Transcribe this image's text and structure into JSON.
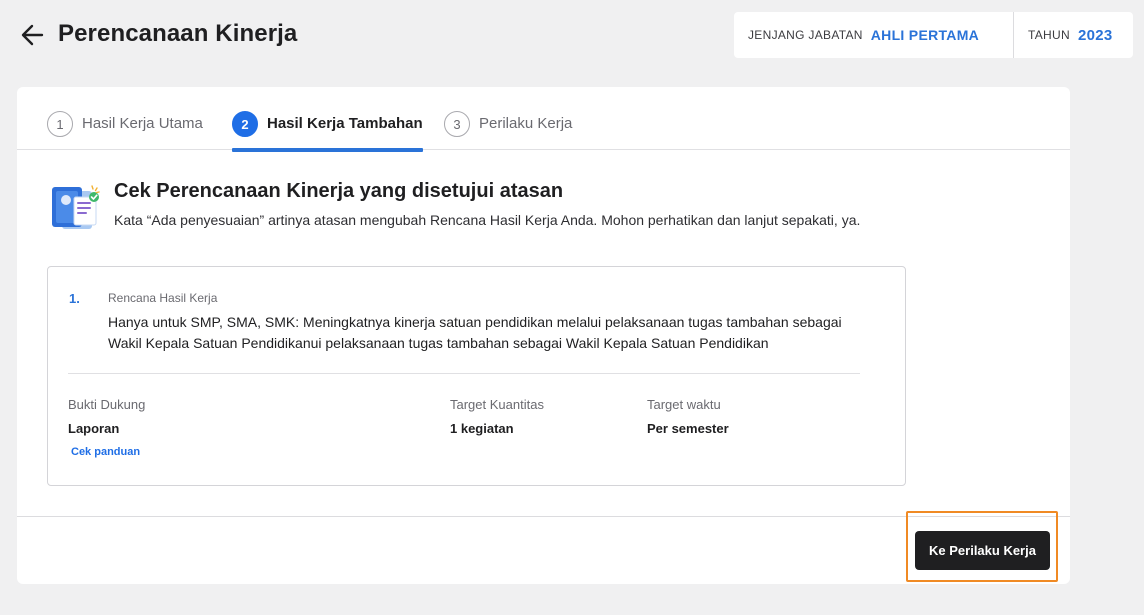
{
  "header": {
    "title": "Perencanaan Kinerja",
    "jenjang_label": "JENJANG JABATAN",
    "jenjang_value": "AHLI PERTAMA",
    "tahun_label": "TAHUN",
    "tahun_value": "2023"
  },
  "stepper": {
    "steps": [
      {
        "number": "1",
        "label": "Hasil Kerja Utama",
        "active": false
      },
      {
        "number": "2",
        "label": "Hasil Kerja Tambahan",
        "active": true
      },
      {
        "number": "3",
        "label": "Perilaku Kerja",
        "active": false
      }
    ]
  },
  "section": {
    "title": "Cek Perencanaan Kinerja yang disetujui atasan",
    "description": "Kata “Ada penyesuaian” artinya atasan mengubah Rencana Hasil Kerja Anda. Mohon perhatikan dan lanjut sepakati, ya."
  },
  "plan": {
    "number": "1.",
    "label": "Rencana Hasil Kerja",
    "text": "Hanya untuk SMP, SMA, SMK: Meningkatnya kinerja satuan pendidikan melalui pelaksanaan tugas tambahan sebagai Wakil Kepala Satuan Pendidikanui pelaksanaan tugas tambahan sebagai Wakil Kepala Satuan Pendidikan",
    "bukti_label": "Bukti Dukung",
    "bukti_value": "Laporan",
    "kuantitas_label": "Target Kuantitas",
    "kuantitas_value": "1 kegiatan",
    "waktu_label": "Target waktu",
    "waktu_value": "Per semester",
    "guide_link": "Cek panduan"
  },
  "footer": {
    "next_button": "Ke Perilaku Kerja"
  },
  "colors": {
    "accent": "#2a73d8",
    "highlight": "#f08a24",
    "button_bg": "#1f1f21"
  },
  "icons": {
    "back": "arrow-left-icon",
    "document": "document-check-icon"
  }
}
